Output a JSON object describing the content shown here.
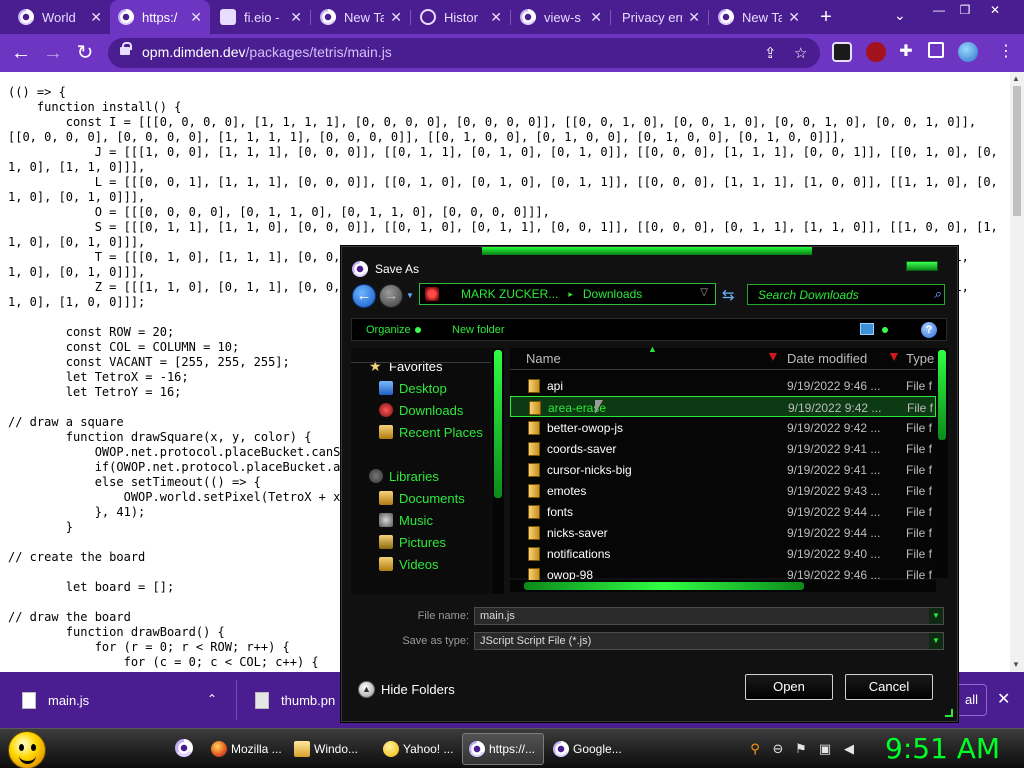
{
  "browser": {
    "tabs": [
      {
        "title": "World",
        "icon": "chrome-icon"
      },
      {
        "title": "https:/",
        "icon": "chrome-icon",
        "active": true
      },
      {
        "title": "fi.eio -",
        "icon": "site-icon"
      },
      {
        "title": "New Ta",
        "icon": "chrome-icon"
      },
      {
        "title": "Histor",
        "icon": "history-icon"
      },
      {
        "title": "view-s",
        "icon": "chrome-icon"
      },
      {
        "title": "Privacy err",
        "icon": "none"
      },
      {
        "title": "New Ta",
        "icon": "chrome-icon"
      }
    ],
    "new_tab_label": "+",
    "tab_search_label": "⌄",
    "window_controls": {
      "minimize": "—",
      "restore": "❐",
      "close": "✕"
    },
    "url_domain": "opm.dimden.dev",
    "url_path": "/packages/tetris/main.js",
    "colors": {
      "frame": "#4a1d91",
      "toolbar": "#6d35c2"
    }
  },
  "page": {
    "code_lines": [
      "(() => {",
      "    function install() {",
      "        const I = [[[0, 0, 0, 0], [1, 1, 1, 1], [0, 0, 0, 0], [0, 0, 0, 0]], [[0, 0, 1, 0], [0, 0, 1, 0], [0, 0, 1, 0], [0, 0, 1, 0]],",
      "[[0, 0, 0, 0], [0, 0, 0, 0], [1, 1, 1, 1], [0, 0, 0, 0]], [[0, 1, 0, 0], [0, 1, 0, 0], [0, 1, 0, 0], [0, 1, 0, 0]]],",
      "            J = [[[1, 0, 0], [1, 1, 1], [0, 0, 0]], [[0, 1, 1], [0, 1, 0], [0, 1, 0]], [[0, 0, 0], [1, 1, 1], [0, 0, 1]], [[0, 1, 0], [0,",
      "1, 0], [1, 1, 0]]],",
      "            L = [[[0, 0, 1], [1, 1, 1], [0, 0, 0]], [[0, 1, 0], [0, 1, 0], [0, 1, 1]], [[0, 0, 0], [1, 1, 1], [1, 0, 0]], [[1, 1, 0], [0,",
      "1, 0], [0, 1, 0]]],",
      "            O = [[[0, 0, 0, 0], [0, 1, 1, 0], [0, 1, 1, 0], [0, 0, 0, 0]]],",
      "            S = [[[0, 1, 1], [1, 1, 0], [0, 0, 0]], [[0, 1, 0], [0, 1, 1], [0, 0, 1]], [[0, 0, 0], [0, 1, 1], [1, 1, 0]], [[1, 0, 0], [1,",
      "1, 0], [0, 1, 0]]],",
      "            T = [[[0, 1, 0], [1, 1, 1], [0, 0,                                                                                    [1,",
      "1, 0], [0, 1, 0]]],",
      "            Z = [[[1, 1, 0], [0, 1, 1], [0, 0,                                                                                    [1,",
      "1, 0], [1, 0, 0]]];",
      "",
      "        const ROW = 20;",
      "        const COL = COLUMN = 10;",
      "        const VACANT = [255, 255, 255];",
      "        let TetroX = -16;",
      "        let TetroY = 16;",
      "",
      "// draw a square",
      "        function drawSquare(x, y, color) {",
      "            OWOP.net.protocol.placeBucket.canS",
      "            if(OWOP.net.protocol.placeBucket.a",
      "            else setTimeout(() => {",
      "                OWOP.world.setPixel(TetroX + x",
      "            }, 41);",
      "        }",
      "",
      "// create the board",
      "",
      "        let board = [];",
      "",
      "// draw the board",
      "        function drawBoard() {",
      "            for (r = 0; r < ROW; r++) {",
      "                for (c = 0; c < COL; c++) {"
    ]
  },
  "downloads_shelf": {
    "items": [
      {
        "name": "main.js"
      },
      {
        "name": "thumb.pn"
      }
    ],
    "show_all_label": "all",
    "close_label": "✕"
  },
  "dialog": {
    "title": "Save As",
    "address": {
      "segments": [
        "MARK ZUCKER...",
        "Downloads"
      ]
    },
    "search_placeholder": "Search Downloads",
    "commands": {
      "organize": "Organize",
      "new_folder": "New folder"
    },
    "nav_pane": {
      "favorites_header": "Favorites",
      "favorites": [
        "Desktop",
        "Downloads",
        "Recent Places"
      ],
      "libraries_header": "Libraries",
      "libraries": [
        "Documents",
        "Music",
        "Pictures",
        "Videos"
      ]
    },
    "columns": {
      "name": "Name",
      "date": "Date modified",
      "type": "Type"
    },
    "files": [
      {
        "name": "api",
        "date": "9/19/2022 9:46 ...",
        "type": "File f"
      },
      {
        "name": "area-erase",
        "date": "9/19/2022 9:42 ...",
        "type": "File f",
        "selected": true
      },
      {
        "name": "better-owop-js",
        "date": "9/19/2022 9:42 ...",
        "type": "File f"
      },
      {
        "name": "coords-saver",
        "date": "9/19/2022 9:41 ...",
        "type": "File f"
      },
      {
        "name": "cursor-nicks-big",
        "date": "9/19/2022 9:41 ...",
        "type": "File f"
      },
      {
        "name": "emotes",
        "date": "9/19/2022 9:43 ...",
        "type": "File f"
      },
      {
        "name": "fonts",
        "date": "9/19/2022 9:44 ...",
        "type": "File f"
      },
      {
        "name": "nicks-saver",
        "date": "9/19/2022 9:44 ...",
        "type": "File f"
      },
      {
        "name": "notifications",
        "date": "9/19/2022 9:40 ...",
        "type": "File f"
      },
      {
        "name": "owop-98",
        "date": "9/19/2022 9:46 ...",
        "type": "File f"
      }
    ],
    "file_name_label": "File name:",
    "file_name_value": "main.js",
    "save_type_label": "Save as type:",
    "save_type_value": "JScript Script File (*.js)",
    "hide_folders_label": "Hide Folders",
    "open_label": "Open",
    "cancel_label": "Cancel",
    "colors": {
      "accent": "#2ee83b",
      "background": "#111111"
    }
  },
  "taskbar": {
    "items": [
      {
        "label": "Mozilla ...",
        "icon": "firefox-icon"
      },
      {
        "label": "Windo...",
        "icon": "folder-icon"
      },
      {
        "label": "Yahoo! ...",
        "icon": "yahoo-icon"
      },
      {
        "label": "https://...",
        "icon": "chrome-icon",
        "active": true
      },
      {
        "label": "Google...",
        "icon": "chrome-icon"
      }
    ],
    "clock": "9:51 AM",
    "clock_color": "#00ff26"
  }
}
